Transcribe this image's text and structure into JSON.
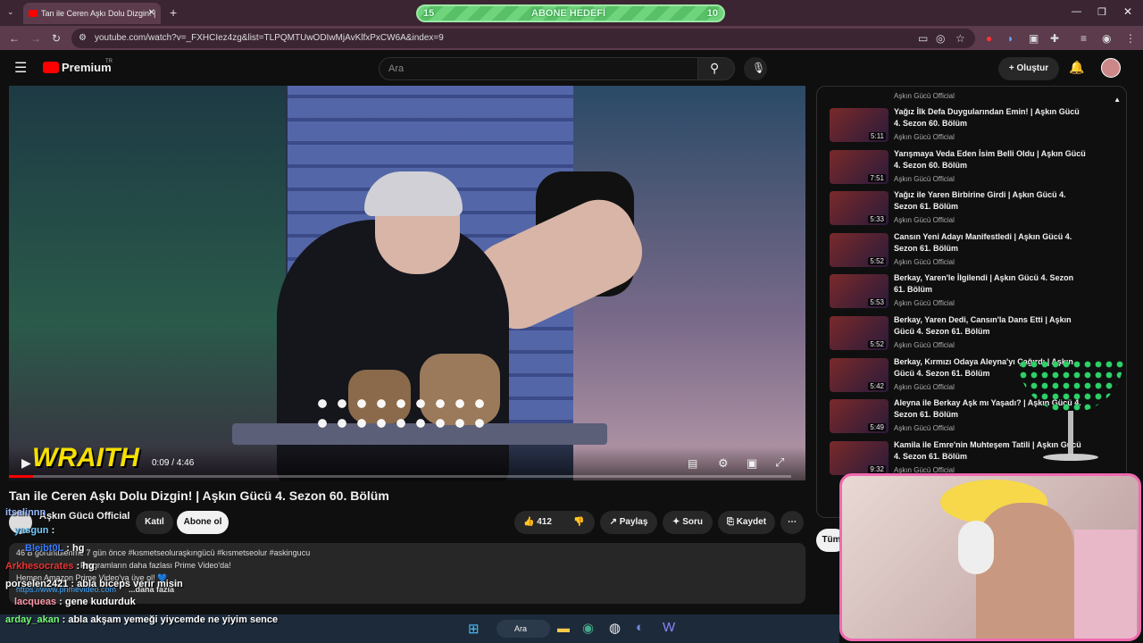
{
  "browser": {
    "tab_title": "Tan ile Ceren Aşkı Dolu Dizgin! |",
    "goal_left": "15",
    "goal_label": "ABONE HEDEFİ",
    "goal_right": "10",
    "url": "youtube.com/watch?v=_FXHCIez4zg&list=TLPQMTUwODIwMjAvKlfxPxCW6A&index=9"
  },
  "yt": {
    "logo": "Premium",
    "logo_sup": "TR",
    "search_placeholder": "Ara",
    "create_label": "Oluştur"
  },
  "player": {
    "time": "0:09 / 4:46",
    "progress": 0.031,
    "overlay_text": "WRAITH"
  },
  "video": {
    "title": "Tan ile Ceren Aşkı Dolu Dizgin! | Aşkın Gücü 4. Sezon 60. Bölüm",
    "channel": "Aşkın Gücü Official",
    "join": "Katıl",
    "subscribe": "Abone ol",
    "likes": "412",
    "share": "Paylaş",
    "ask": "Soru",
    "save": "Kaydet"
  },
  "description": {
    "meta": "46 B görüntülenme  7 gün önce  #kısmetseoluraşkıngücü #kısmetseolur #askingucu",
    "line2": "Programların daha fazlası Prime Video'da!",
    "line3": "Hemen Amazon Prime Video'ya üye ol! 💙",
    "link": "https://www.primevideo.com",
    "more": "...daha fazla"
  },
  "chat": [
    {
      "user": "itsalinnn",
      "text": ""
    },
    {
      "user": "yasgun",
      "text": ":"
    },
    {
      "user": "Bleibt0L",
      "text": ": hg"
    },
    {
      "user": "Arkhesocrates",
      "text": ": hg"
    },
    {
      "user": "porselen2421",
      "text": ": abla biceps verir misin"
    },
    {
      "user": "lacqueas",
      "text": ": gene kudurduk"
    },
    {
      "user": "arday_akan",
      "text": ": abla akşam yemeği yiycemde ne yiyim sence"
    }
  ],
  "sidebar": {
    "top_channel": "Aşkın Gücü Official",
    "items": [
      {
        "title": "Yağız İlk Defa Duygularından Emin! | Aşkın Gücü 4. Sezon 60. Bölüm",
        "channel": "Aşkın Gücü Official",
        "duration": "5:11"
      },
      {
        "title": "Yarışmaya Veda Eden İsim Belli Oldu | Aşkın Gücü 4. Sezon 60. Bölüm",
        "channel": "Aşkın Gücü Official",
        "duration": "7:51"
      },
      {
        "title": "Yağız ile Yaren Birbirine Girdi | Aşkın Gücü 4. Sezon 61. Bölüm",
        "channel": "Aşkın Gücü Official",
        "duration": "5:33"
      },
      {
        "title": "Cansın Yeni Adayı Manifestledi | Aşkın Gücü 4. Sezon 61. Bölüm",
        "channel": "Aşkın Gücü Official",
        "duration": "5:52"
      },
      {
        "title": "Berkay, Yaren'le İlgilendi | Aşkın Gücü 4. Sezon 61. Bölüm",
        "channel": "Aşkın Gücü Official",
        "duration": "5:53"
      },
      {
        "title": "Berkay, Yaren Dedi, Cansın'la Dans Etti | Aşkın Gücü 4. Sezon 61. Bölüm",
        "channel": "Aşkın Gücü Official",
        "duration": "5:52"
      },
      {
        "title": "Berkay, Kırmızı Odaya Aleyna'yı Çağırdı | Aşkın Gücü 4. Sezon 61. Bölüm",
        "channel": "Aşkın Gücü Official",
        "duration": "5:42"
      },
      {
        "title": "Aleyna ile Berkay Aşk mı Yaşadı? | Aşkın Gücü 4. Sezon 61. Bölüm",
        "channel": "Aşkın Gücü Official",
        "duration": "5:49"
      },
      {
        "title": "Kamila ile Emre'nin Muhteşem Tatili | Aşkın Gücü 4. Sezon 61. Bölüm",
        "channel": "Aşkın Gücü Official",
        "duration": "9:32"
      }
    ],
    "chip": "Tüm"
  },
  "taskbar": {
    "search": "Ara"
  }
}
